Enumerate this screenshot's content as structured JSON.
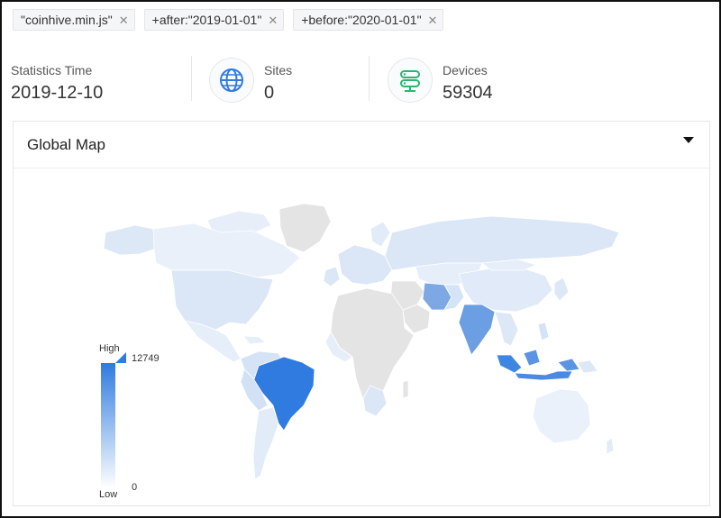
{
  "filters": [
    {
      "label": "\"coinhive.min.js\""
    },
    {
      "label": "+after:\"2019-01-01\""
    },
    {
      "label": "+before:\"2020-01-01\""
    }
  ],
  "stats": {
    "time": {
      "label": "Statistics Time",
      "value": "2019-12-10"
    },
    "sites": {
      "label": "Sites",
      "value": "0",
      "icon": "globe-icon"
    },
    "devices": {
      "label": "Devices",
      "value": "59304",
      "icon": "server-icon"
    }
  },
  "map": {
    "title": "Global Map",
    "legend": {
      "high": "High",
      "low": "Low",
      "max": "12749",
      "min": "0"
    },
    "colors": {
      "no_data": "#e4e4e4",
      "low": "#dde8f7",
      "mid": "#a9c6ee",
      "high": "#2f7be0"
    }
  }
}
